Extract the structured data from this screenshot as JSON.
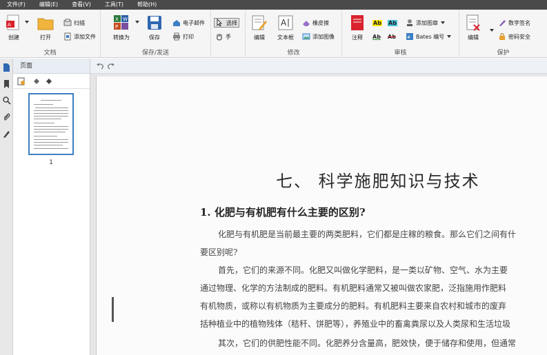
{
  "menu": [
    "文件(F)",
    "编辑(E)",
    "查看(V)",
    "工具(T)",
    "帮助(H)"
  ],
  "ribbon": {
    "file": {
      "create": "创建",
      "open": "打开",
      "scan": "扫描",
      "add_file": "添加文件",
      "label": "文档"
    },
    "save": {
      "convert": "转换为",
      "save": "保存",
      "email": "电子邮件",
      "print": "打印",
      "label": "保存/发送"
    },
    "select": {
      "select": "选择",
      "hand": "手"
    },
    "modify": {
      "edit": "编辑",
      "textbox": "文本框",
      "eraser": "橡皮擦",
      "add_image": "添加图像",
      "label": "修改"
    },
    "review": {
      "annotate": "注释",
      "add_stamp": "添加图章",
      "bates": "Bates 编号",
      "label": "审核",
      "ab": "Ab"
    },
    "protect": {
      "edit": "编辑",
      "digital_sign": "数字签名",
      "password": "密码安全",
      "label": "保护"
    }
  },
  "panel": {
    "title": "页面",
    "thumb_page": "1"
  },
  "document": {
    "title": "七、 科学施肥知识与技术",
    "heading": "1.    化肥与有机肥有什么主要的区别?",
    "lines": [
      "化肥与有机肥是当前最主要的两类肥料，它们都是庄稼的粮食。那么它们之间有什",
      "要区别呢?",
      "首先，它们的来源不同。化肥又叫做化学肥料，是一类以矿物、空气、水为主要",
      "通过物理、化学的方法制成的肥料。有机肥料通常又被叫做农家肥，泛指施用作肥料",
      "有机物质，或称以有机物质为主要成分的肥料。有机肥料主要来自农村和城市的废弃",
      "括种植业中的植物残体（秸秆、饼肥等），养殖业中的畜禽粪尿以及人类尿和生活垃圾",
      "其次，它们的供肥性能不同。化肥养分含量高，肥效快，便于储存和使用，但通常"
    ]
  },
  "colors": {
    "menubar": "#4a4a4a",
    "accent": "#3d7fc4",
    "folder": "#f0b43c",
    "red": "#d9232d"
  }
}
